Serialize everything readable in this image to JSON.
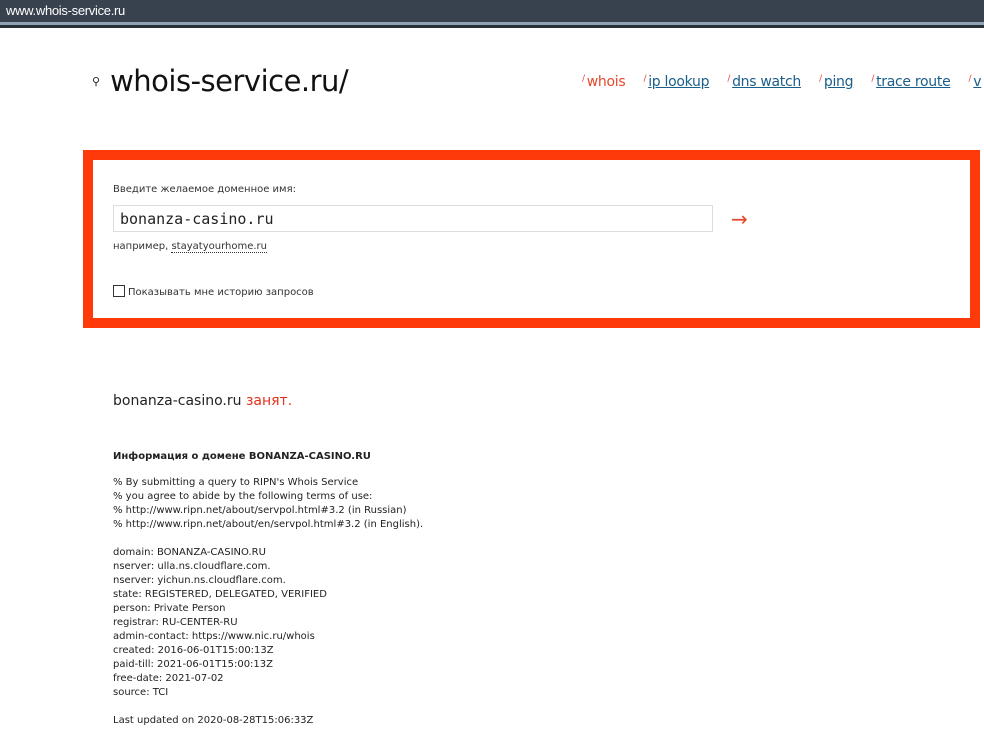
{
  "address_bar": {
    "url": "www.whois-service.ru"
  },
  "logo": {
    "text": "whois-service.ru/",
    "icon": "search-icon"
  },
  "nav": [
    {
      "label": "whois",
      "active": true
    },
    {
      "label": "ip lookup"
    },
    {
      "label": "dns watch"
    },
    {
      "label": "ping"
    },
    {
      "label": "trace route"
    },
    {
      "label": "v"
    }
  ],
  "form": {
    "label": "Введите желаемое доменное имя:",
    "value": "bonanza-casino.ru",
    "submit_icon": "→",
    "example_prefix": "например,",
    "example_link": "stayatyourhome.ru",
    "history_label": "Показывать мне историю запросов"
  },
  "result": {
    "domain": "bonanza-casino.ru",
    "status": "занят."
  },
  "info": {
    "heading": "Информация о домене BONANZA-CASINO.RU",
    "terms": [
      "% By submitting a query to RIPN's Whois Service",
      "% you agree to abide by the following terms of use:",
      "% http://www.ripn.net/about/servpol.html#3.2 (in Russian)",
      "% http://www.ripn.net/about/en/servpol.html#3.2 (in English)."
    ],
    "records": [
      "domain: BONANZA-CASINO.RU",
      "nserver: ulla.ns.cloudflare.com.",
      "nserver: yichun.ns.cloudflare.com.",
      "state: REGISTERED, DELEGATED, VERIFIED",
      "person: Private Person",
      "registrar: RU-CENTER-RU",
      "admin-contact: https://www.nic.ru/whois",
      "created: 2016-06-01T15:00:13Z",
      "paid-till: 2021-06-01T15:00:13Z",
      "free-date: 2021-07-02",
      "source: TCI"
    ],
    "updated": "Last updated on 2020-08-28T15:06:33Z"
  },
  "colors": {
    "accent": "#e5482c",
    "highlight_border": "#ff3a0a",
    "link": "#1a5e8a"
  }
}
